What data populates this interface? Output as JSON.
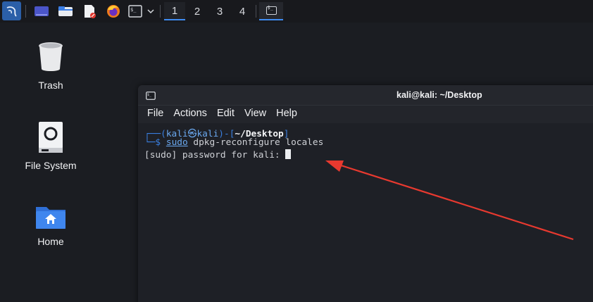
{
  "panel": {
    "workspaces": [
      "1",
      "2",
      "3",
      "4"
    ],
    "active_workspace": "1",
    "launchers": [
      "kali-menu-icon",
      "show-desktop-icon",
      "file-manager-icon",
      "text-editor-icon",
      "firefox-icon",
      "terminal-icon"
    ]
  },
  "desktop": {
    "icons": [
      {
        "label": "Trash",
        "icon": "trash-icon"
      },
      {
        "label": "File System",
        "icon": "drive-icon"
      },
      {
        "label": "Home",
        "icon": "home-folder-icon"
      }
    ]
  },
  "terminal": {
    "title": "kali@kali: ~/Desktop",
    "menu": [
      "File",
      "Actions",
      "Edit",
      "View",
      "Help"
    ],
    "prompt": {
      "corner_top": "┌──(",
      "user": "kali",
      "at": "㉿",
      "host": "kali",
      "mid": ")-[",
      "path": "~/Desktop",
      "close": "]",
      "corner_bottom": "└─",
      "dollar": "$",
      "cmd_sudo": "sudo",
      "cmd_rest": " dpkg-reconfigure locales"
    },
    "output_line": "[sudo] password for kali: "
  },
  "annotation": {
    "color": "#e8392f"
  }
}
